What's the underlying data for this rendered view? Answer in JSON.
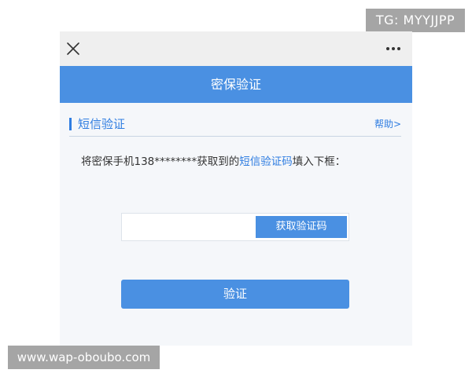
{
  "watermarks": {
    "tg": "TG: MYYJJPP",
    "url": "www.wap-oboubo.com"
  },
  "topbar": {
    "close_icon": "close-icon",
    "more_icon": "more-icon"
  },
  "header": {
    "title": "密保验证"
  },
  "section": {
    "title": "短信验证",
    "help": "帮助>"
  },
  "instruction": {
    "prefix": "将密保手机138********获取到的",
    "highlight": "短信验证码",
    "suffix": "填入下框："
  },
  "code_input": {
    "value": "",
    "placeholder": "",
    "button_label": "获取验证码"
  },
  "verify_button": {
    "label": "验证"
  },
  "colors": {
    "accent": "#4a90e2",
    "link": "#2f7de1",
    "topbar_bg": "#efefef",
    "page_bg": "#f5f7fa"
  }
}
